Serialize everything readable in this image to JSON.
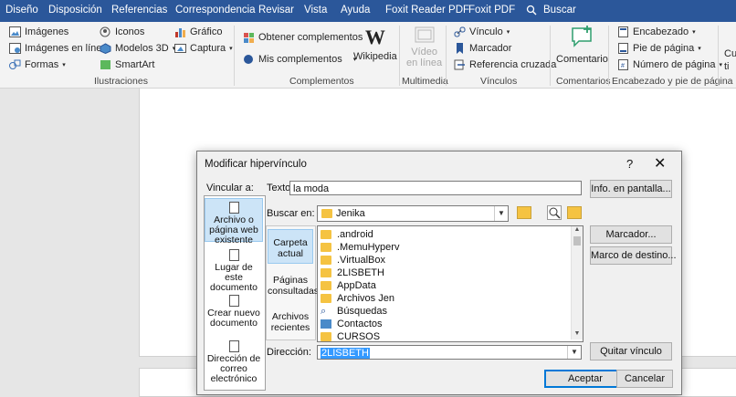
{
  "menubar": {
    "tabs": [
      "Diseño",
      "Disposición",
      "Referencias",
      "Correspondencia",
      "Revisar",
      "Vista",
      "Ayuda",
      "Foxit Reader PDF",
      "Foxit PDF"
    ],
    "search_label": "Buscar"
  },
  "ribbon": {
    "ilustraciones": {
      "imagenes": "Imágenes",
      "imagenes_linea": "Imágenes en línea",
      "formas": "Formas",
      "iconos": "Iconos",
      "modelos3d": "Modelos 3D",
      "smartart": "SmartArt",
      "grafico": "Gráfico",
      "captura": "Captura",
      "group_name": "Ilustraciones"
    },
    "complementos": {
      "obtener": "Obtener complementos",
      "mis": "Mis complementos",
      "wikipedia": "Wikipedia",
      "group_name": "Complementos"
    },
    "multimedia": {
      "video_line1": "Vídeo",
      "video_line2": "en línea",
      "group_name": "Multimedia"
    },
    "vinculos": {
      "vinculo": "Vínculo",
      "marcador": "Marcador",
      "referencia": "Referencia cruzada",
      "group_name": "Vínculos"
    },
    "comentarios": {
      "comentario": "Comentario",
      "group_name": "Comentarios"
    },
    "encabezado": {
      "encabezado": "Encabezado",
      "pie": "Pie de página",
      "numero": "Número de página",
      "group_name": "Encabezado y pie de página"
    },
    "cut_label": "Cu\nti"
  },
  "dialog": {
    "title": "Modificar hipervínculo",
    "help": "?",
    "close": "✕",
    "vincular_label": "Vincular a:",
    "link_types": [
      {
        "line1": "Archivo o",
        "line2": "página web",
        "line3": "existente"
      },
      {
        "line1": "Lugar de este",
        "line2": "documento",
        "line3": ""
      },
      {
        "line1": "Crear nuevo",
        "line2": "documento",
        "line3": ""
      },
      {
        "line1": "Dirección de",
        "line2": "correo",
        "line3": "electrónico"
      }
    ],
    "texto_label": "Texto:",
    "texto_value": "la moda",
    "info_button": "Info. en pantalla...",
    "buscar_label": "Buscar en:",
    "buscar_value": "Jenika",
    "nav_items": [
      {
        "line1": "Carpeta",
        "line2": "actual"
      },
      {
        "line1": "Páginas",
        "line2": "consultadas"
      },
      {
        "line1": "Archivos",
        "line2": "recientes"
      }
    ],
    "files": [
      ".android",
      ".MemuHyperv",
      ".VirtualBox",
      "2LISBETH",
      "AppData",
      "Archivos Jen",
      "Búsquedas",
      "Contactos",
      "CURSOS"
    ],
    "marcador_button": "Marcador...",
    "marco_button": "Marco de destino...",
    "direccion_label": "Dirección:",
    "direccion_value": "2LISBETH",
    "quitar_button": "Quitar vínculo",
    "aceptar_button": "Aceptar",
    "cancelar_button": "Cancelar"
  }
}
